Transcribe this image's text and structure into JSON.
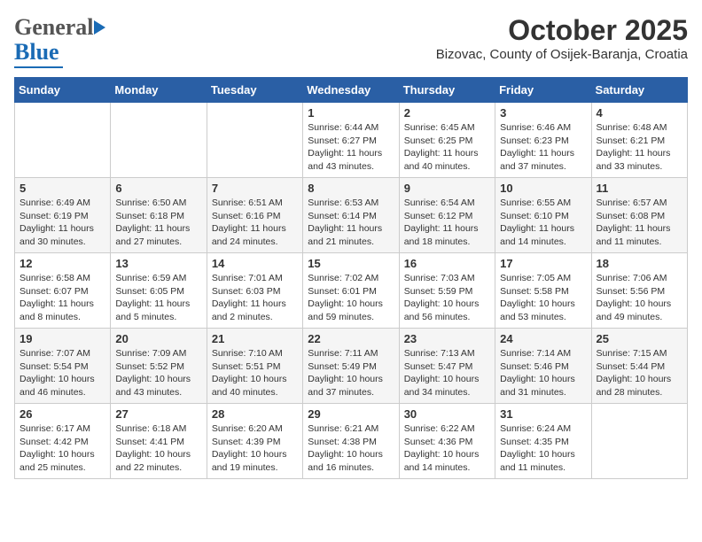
{
  "logo": {
    "general": "General",
    "blue": "Blue"
  },
  "title": "October 2025",
  "subtitle": "Bizovac, County of Osijek-Baranja, Croatia",
  "weekdays": [
    "Sunday",
    "Monday",
    "Tuesday",
    "Wednesday",
    "Thursday",
    "Friday",
    "Saturday"
  ],
  "weeks": [
    [
      {
        "day": "",
        "info": ""
      },
      {
        "day": "",
        "info": ""
      },
      {
        "day": "",
        "info": ""
      },
      {
        "day": "1",
        "info": "Sunrise: 6:44 AM\nSunset: 6:27 PM\nDaylight: 11 hours\nand 43 minutes."
      },
      {
        "day": "2",
        "info": "Sunrise: 6:45 AM\nSunset: 6:25 PM\nDaylight: 11 hours\nand 40 minutes."
      },
      {
        "day": "3",
        "info": "Sunrise: 6:46 AM\nSunset: 6:23 PM\nDaylight: 11 hours\nand 37 minutes."
      },
      {
        "day": "4",
        "info": "Sunrise: 6:48 AM\nSunset: 6:21 PM\nDaylight: 11 hours\nand 33 minutes."
      }
    ],
    [
      {
        "day": "5",
        "info": "Sunrise: 6:49 AM\nSunset: 6:19 PM\nDaylight: 11 hours\nand 30 minutes."
      },
      {
        "day": "6",
        "info": "Sunrise: 6:50 AM\nSunset: 6:18 PM\nDaylight: 11 hours\nand 27 minutes."
      },
      {
        "day": "7",
        "info": "Sunrise: 6:51 AM\nSunset: 6:16 PM\nDaylight: 11 hours\nand 24 minutes."
      },
      {
        "day": "8",
        "info": "Sunrise: 6:53 AM\nSunset: 6:14 PM\nDaylight: 11 hours\nand 21 minutes."
      },
      {
        "day": "9",
        "info": "Sunrise: 6:54 AM\nSunset: 6:12 PM\nDaylight: 11 hours\nand 18 minutes."
      },
      {
        "day": "10",
        "info": "Sunrise: 6:55 AM\nSunset: 6:10 PM\nDaylight: 11 hours\nand 14 minutes."
      },
      {
        "day": "11",
        "info": "Sunrise: 6:57 AM\nSunset: 6:08 PM\nDaylight: 11 hours\nand 11 minutes."
      }
    ],
    [
      {
        "day": "12",
        "info": "Sunrise: 6:58 AM\nSunset: 6:07 PM\nDaylight: 11 hours\nand 8 minutes."
      },
      {
        "day": "13",
        "info": "Sunrise: 6:59 AM\nSunset: 6:05 PM\nDaylight: 11 hours\nand 5 minutes."
      },
      {
        "day": "14",
        "info": "Sunrise: 7:01 AM\nSunset: 6:03 PM\nDaylight: 11 hours\nand 2 minutes."
      },
      {
        "day": "15",
        "info": "Sunrise: 7:02 AM\nSunset: 6:01 PM\nDaylight: 10 hours\nand 59 minutes."
      },
      {
        "day": "16",
        "info": "Sunrise: 7:03 AM\nSunset: 5:59 PM\nDaylight: 10 hours\nand 56 minutes."
      },
      {
        "day": "17",
        "info": "Sunrise: 7:05 AM\nSunset: 5:58 PM\nDaylight: 10 hours\nand 53 minutes."
      },
      {
        "day": "18",
        "info": "Sunrise: 7:06 AM\nSunset: 5:56 PM\nDaylight: 10 hours\nand 49 minutes."
      }
    ],
    [
      {
        "day": "19",
        "info": "Sunrise: 7:07 AM\nSunset: 5:54 PM\nDaylight: 10 hours\nand 46 minutes."
      },
      {
        "day": "20",
        "info": "Sunrise: 7:09 AM\nSunset: 5:52 PM\nDaylight: 10 hours\nand 43 minutes."
      },
      {
        "day": "21",
        "info": "Sunrise: 7:10 AM\nSunset: 5:51 PM\nDaylight: 10 hours\nand 40 minutes."
      },
      {
        "day": "22",
        "info": "Sunrise: 7:11 AM\nSunset: 5:49 PM\nDaylight: 10 hours\nand 37 minutes."
      },
      {
        "day": "23",
        "info": "Sunrise: 7:13 AM\nSunset: 5:47 PM\nDaylight: 10 hours\nand 34 minutes."
      },
      {
        "day": "24",
        "info": "Sunrise: 7:14 AM\nSunset: 5:46 PM\nDaylight: 10 hours\nand 31 minutes."
      },
      {
        "day": "25",
        "info": "Sunrise: 7:15 AM\nSunset: 5:44 PM\nDaylight: 10 hours\nand 28 minutes."
      }
    ],
    [
      {
        "day": "26",
        "info": "Sunrise: 6:17 AM\nSunset: 4:42 PM\nDaylight: 10 hours\nand 25 minutes."
      },
      {
        "day": "27",
        "info": "Sunrise: 6:18 AM\nSunset: 4:41 PM\nDaylight: 10 hours\nand 22 minutes."
      },
      {
        "day": "28",
        "info": "Sunrise: 6:20 AM\nSunset: 4:39 PM\nDaylight: 10 hours\nand 19 minutes."
      },
      {
        "day": "29",
        "info": "Sunrise: 6:21 AM\nSunset: 4:38 PM\nDaylight: 10 hours\nand 16 minutes."
      },
      {
        "day": "30",
        "info": "Sunrise: 6:22 AM\nSunset: 4:36 PM\nDaylight: 10 hours\nand 14 minutes."
      },
      {
        "day": "31",
        "info": "Sunrise: 6:24 AM\nSunset: 4:35 PM\nDaylight: 10 hours\nand 11 minutes."
      },
      {
        "day": "",
        "info": ""
      }
    ]
  ]
}
